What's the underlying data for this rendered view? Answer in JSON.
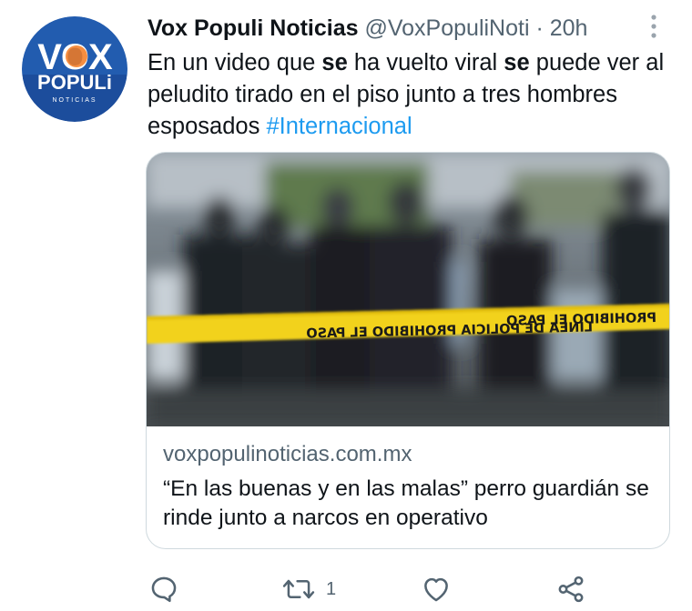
{
  "author": {
    "name": "Vox Populi Noticias",
    "handle": "@VoxPopuliNoti",
    "separator": "·",
    "time": "20h",
    "avatar_text": {
      "top": "VOX",
      "middle": "POPULi",
      "bottom": "NOTICIAS"
    }
  },
  "tweet": {
    "segments": [
      {
        "text": "En un video que ",
        "style": "normal"
      },
      {
        "text": "se",
        "style": "bold"
      },
      {
        "text": " ha vuelto viral ",
        "style": "normal"
      },
      {
        "text": "se",
        "style": "bold"
      },
      {
        "text": " puede ver al peludito tirado en el piso junto a tres hombres esposados ",
        "style": "normal"
      },
      {
        "text": "#Internacional",
        "style": "hashtag"
      }
    ]
  },
  "card": {
    "image_tape_text_left": "LINEA DE POLICIA PROHIBIDO EL PASO",
    "image_tape_text_right": "PROHIBIDO EL PASO",
    "domain": "voxpopulinoticias.com.mx",
    "title": "“En las buenas y en las malas” perro guardián se rinde junto a narcos en operativo"
  },
  "actions": {
    "reply_icon": "reply-icon",
    "retweet_icon": "retweet-icon",
    "retweet_count": "1",
    "like_icon": "heart-icon",
    "share_icon": "share-icon"
  },
  "colors": {
    "text": "#0f1419",
    "muted": "#536471",
    "link": "#1d9bf0",
    "border": "#cfd9de",
    "brand_blue": "#1c4d9c",
    "brand_orange": "#f47a20",
    "tape_yellow": "#f2d21a"
  }
}
